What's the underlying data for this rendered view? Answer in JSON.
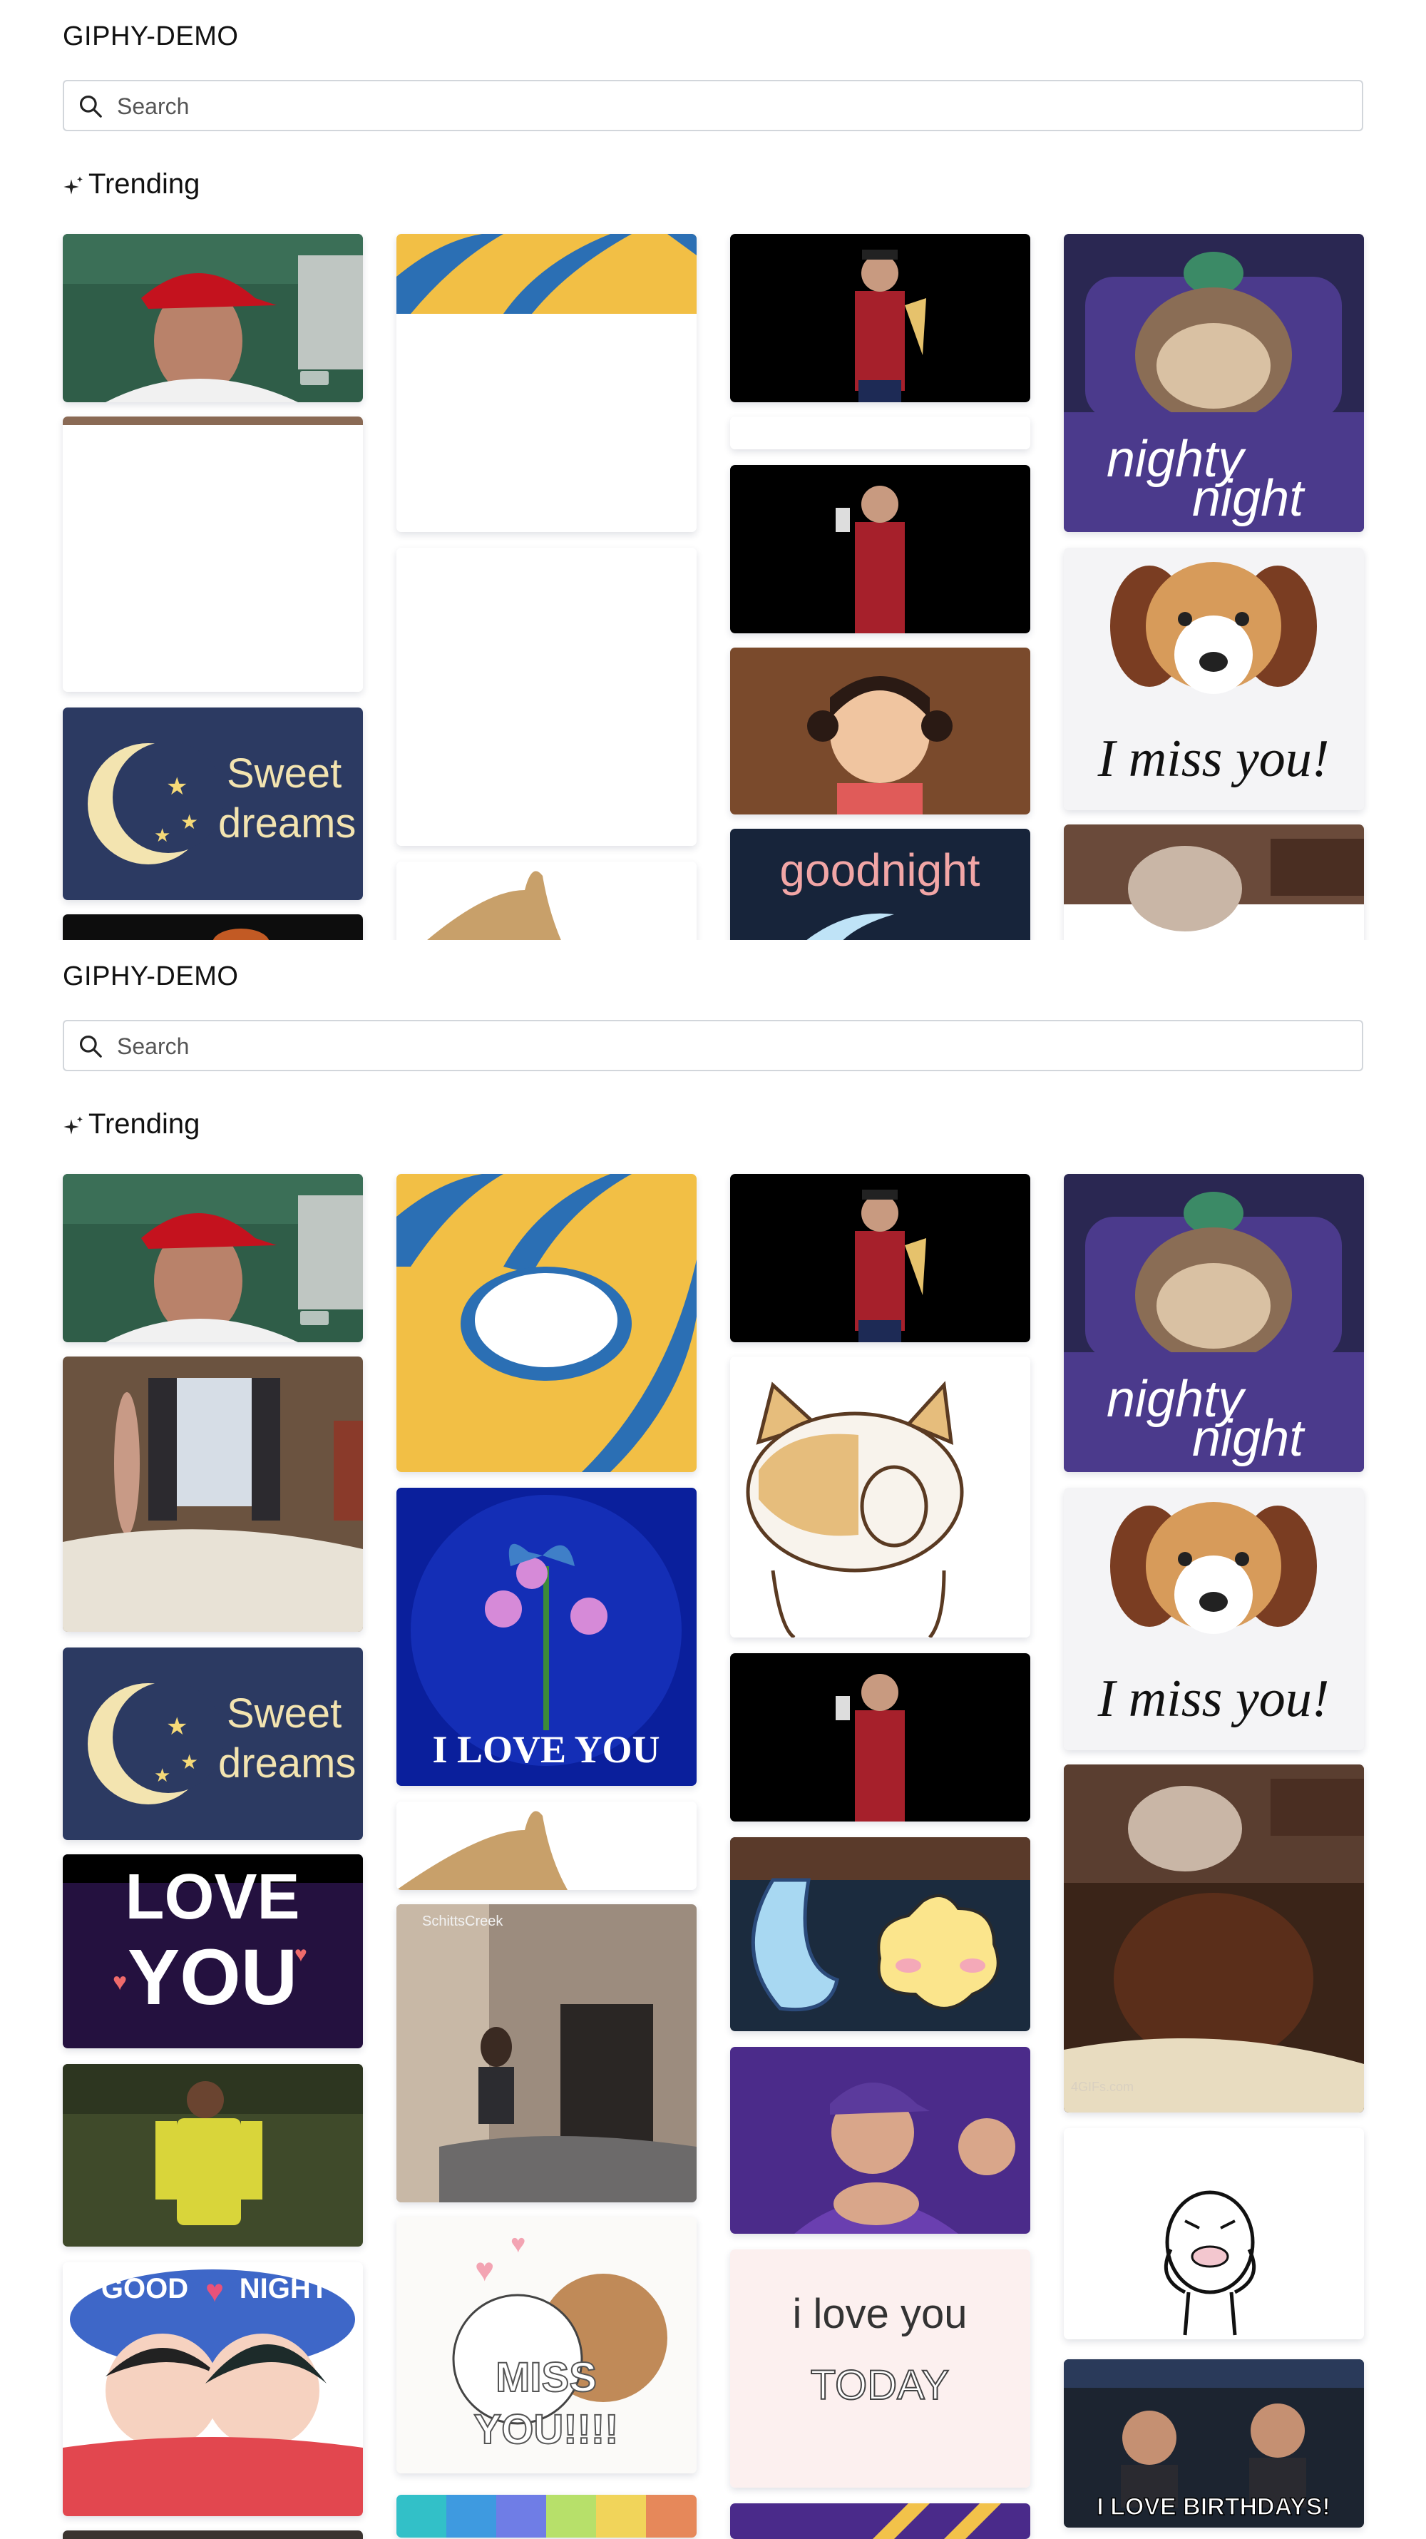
{
  "app": {
    "title": "GIPHY-DEMO"
  },
  "search": {
    "placeholder": "Search",
    "value": ""
  },
  "section": {
    "title": "Trending"
  },
  "gifs": {
    "sweet_dreams": [
      "Sweet",
      "dreams"
    ],
    "nighty_night": [
      "nighty",
      "night"
    ],
    "miss_you": "I miss you!",
    "goodnight": "goodnight",
    "i_love_you": "I LOVE YOU",
    "love_you": [
      "LOVE",
      "YOU"
    ],
    "good_night": [
      "GOOD",
      "NIGHT"
    ],
    "miss_you_caps": [
      "MISS",
      "YOU!!!!"
    ],
    "love_you_today": [
      "i love you",
      "TODAY"
    ],
    "birthdays": "I LOVE BIRTHDAYS!",
    "schitts_creek": "SchittsCreek",
    "gifs_watermark": "4GIFs.com"
  },
  "colors": {
    "background": "#ffffff",
    "border": "#d2d6db",
    "navy": "#2c3a62",
    "purple": "#4b3a8c"
  }
}
